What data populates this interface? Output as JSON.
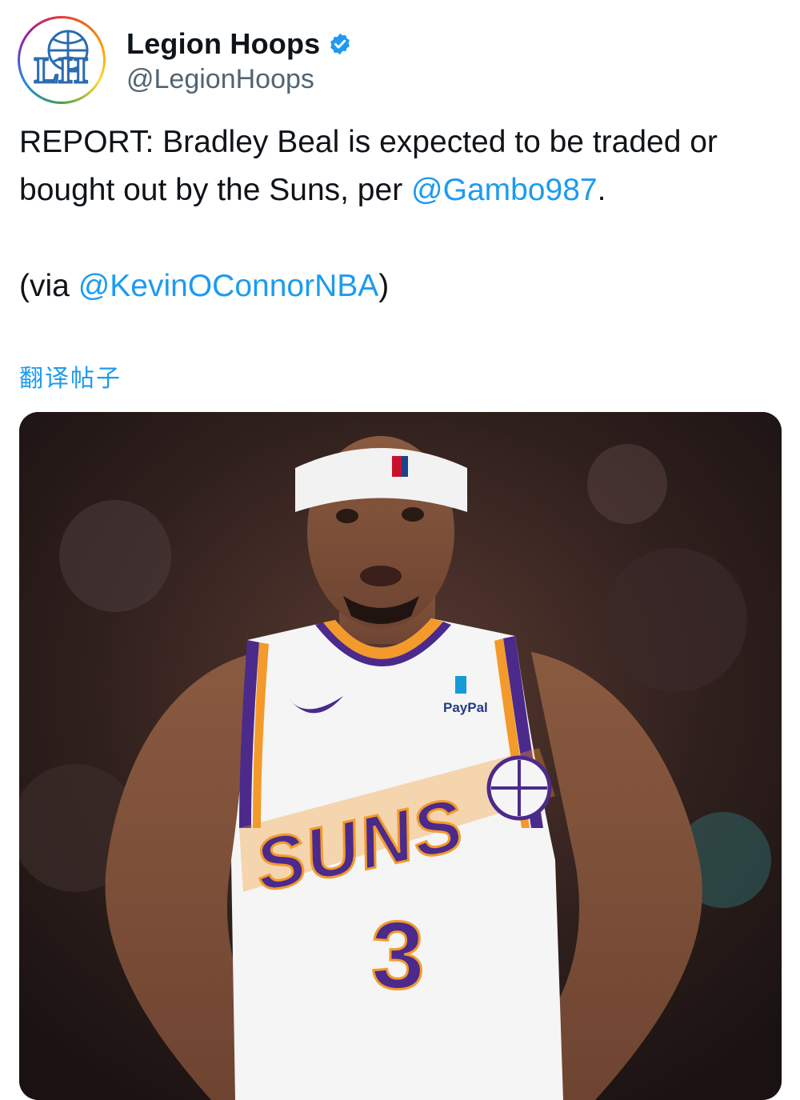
{
  "author": {
    "display_name": "Legion Hoops",
    "handle": "@LegionHoops",
    "verified": true,
    "avatar_icon": "legion-hoops-logo",
    "avatar_logo_text": "LH"
  },
  "tweet": {
    "line1_text": "REPORT: Bradley Beal is expected to be traded or bought out by the Suns, per ",
    "line1_mention": "@Gambo987",
    "line1_end": ".",
    "line2_prefix": "(via ",
    "line2_mention": "@KevinOConnorNBA",
    "line2_end": ")"
  },
  "translate_label": "翻译帖子",
  "media": {
    "jersey_text": "SUNS",
    "jersey_number": "3",
    "sponsor": "PayPal"
  },
  "colors": {
    "link": "#1d9bf0",
    "text": "#0f1419",
    "secondary": "#536471",
    "suns_purple": "#4b2a8c",
    "suns_orange": "#f39a2a"
  }
}
